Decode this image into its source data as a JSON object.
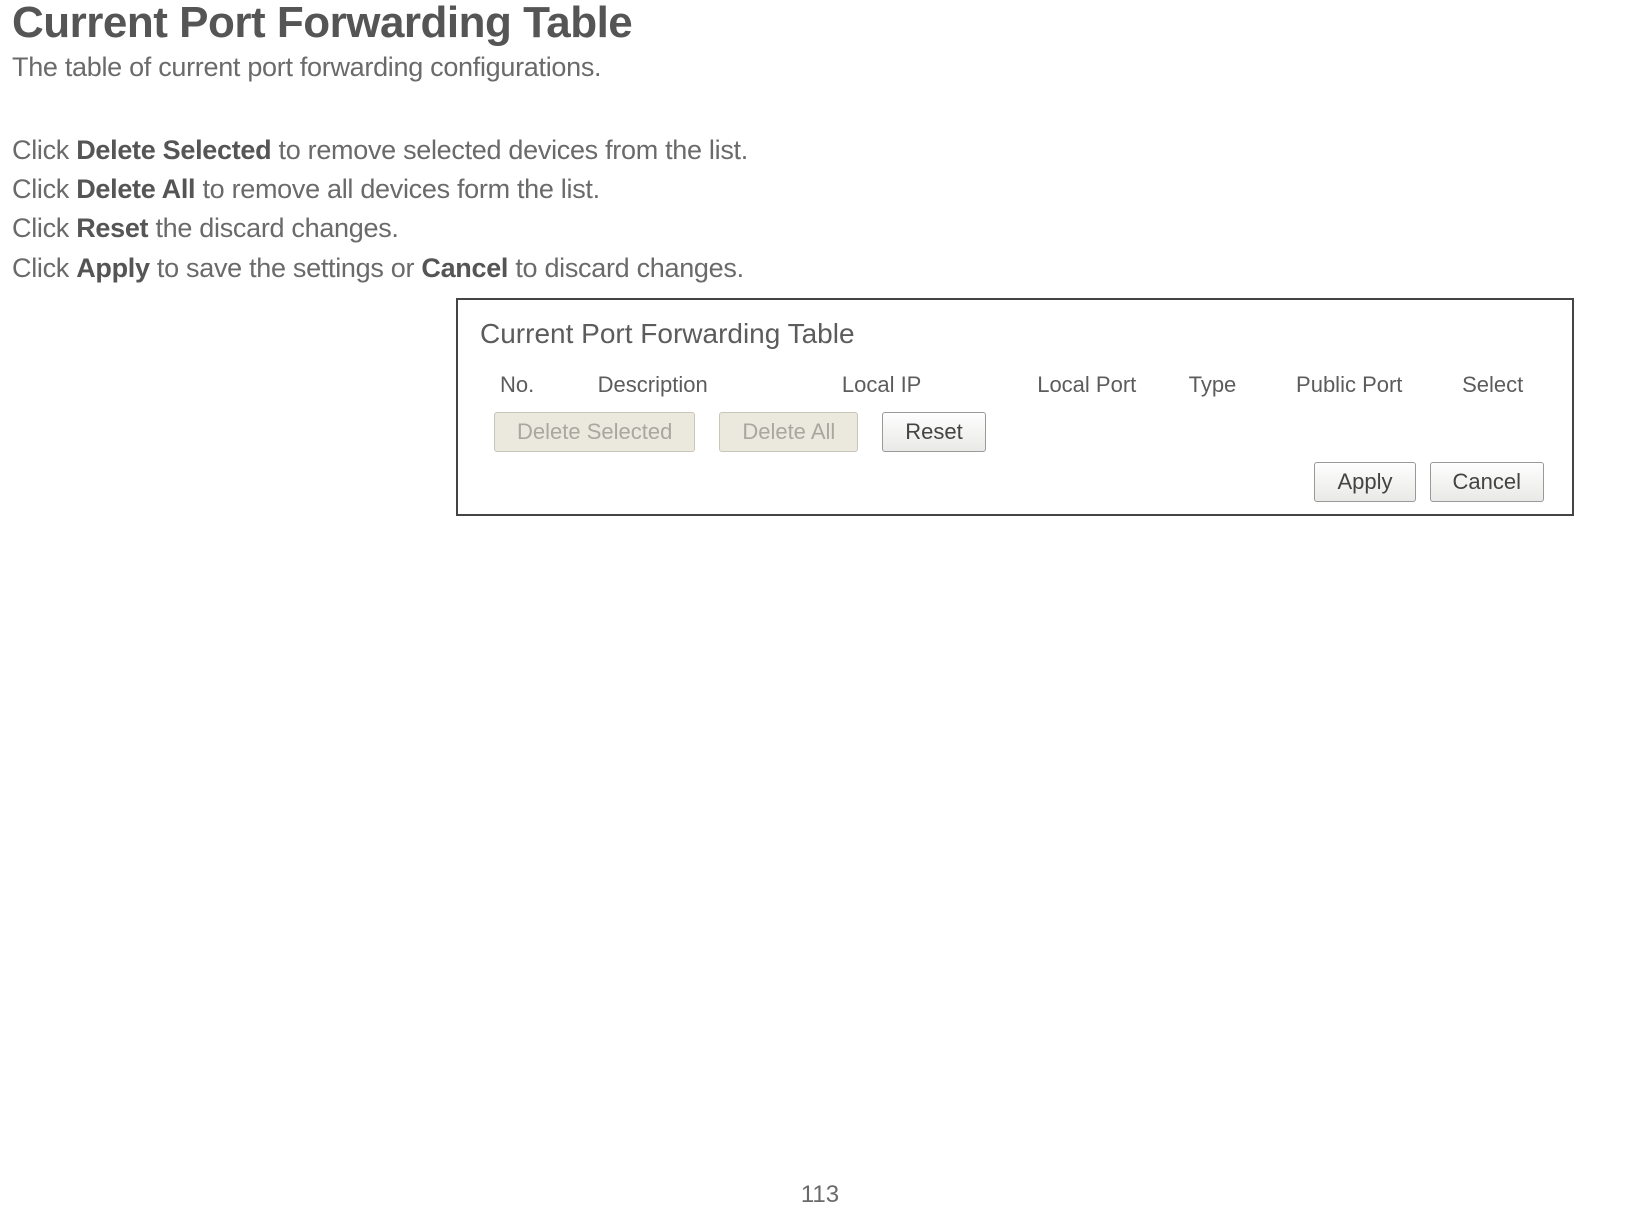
{
  "heading": "Current Port Forwarding Table",
  "subtitle": "The table of current port forwarding configurations.",
  "instructions": {
    "line1_pre": "Click ",
    "line1_b": "Delete Selected",
    "line1_post": " to remove selected devices from the list.",
    "line2_pre": "Click ",
    "line2_b": "Delete All",
    "line2_post": " to remove all devices form the list.",
    "line3_pre": "Click ",
    "line3_b": "Reset",
    "line3_post": " the discard changes.",
    "line4_pre": "Click ",
    "line4_b1": "Apply",
    "line4_mid": " to save the settings or ",
    "line4_b2": "Cancel",
    "line4_post": " to discard changes."
  },
  "panel": {
    "title": "Current Port Forwarding Table",
    "columns": {
      "no": "No.",
      "description": "Description",
      "local_ip": "Local IP",
      "local_port": "Local Port",
      "type": "Type",
      "public_port": "Public Port",
      "select": "Select"
    },
    "buttons": {
      "delete_selected": "Delete Selected",
      "delete_all": "Delete All",
      "reset": "Reset",
      "apply": "Apply",
      "cancel": "Cancel"
    }
  },
  "page_number": "113"
}
